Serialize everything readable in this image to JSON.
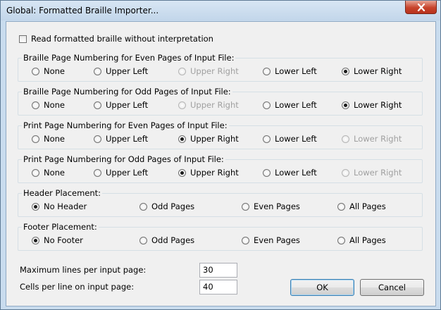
{
  "window": {
    "title": "Global: Formatted Braille Importer..."
  },
  "options": {
    "raw_checkbox_label": "Read formatted braille without interpretation",
    "raw_checked": false
  },
  "groups": [
    {
      "label": "Braille Page Numbering for Even Pages of Input File:",
      "options": [
        "None",
        "Upper Left",
        "Upper Right",
        "Lower Left",
        "Lower Right"
      ],
      "selected": "Lower Right",
      "disabled": [
        "Upper Right"
      ]
    },
    {
      "label": "Braille Page Numbering for Odd Pages of Input File:",
      "options": [
        "None",
        "Upper Left",
        "Upper Right",
        "Lower Left",
        "Lower Right"
      ],
      "selected": "Lower Right",
      "disabled": [
        "Upper Right"
      ]
    },
    {
      "label": "Print Page Numbering for Even Pages of Input File:",
      "options": [
        "None",
        "Upper Left",
        "Upper Right",
        "Lower Left",
        "Lower Right"
      ],
      "selected": "Upper Right",
      "disabled": [
        "Lower Right"
      ]
    },
    {
      "label": "Print Page Numbering for Odd Pages of Input File:",
      "options": [
        "None",
        "Upper Left",
        "Upper Right",
        "Lower Left",
        "Lower Right"
      ],
      "selected": "Upper Right",
      "disabled": [
        "Lower Right"
      ]
    },
    {
      "label": "Header Placement:",
      "options": [
        "No Header",
        "Odd Pages",
        "Even Pages",
        "All Pages"
      ],
      "selected": "No Header",
      "disabled": []
    },
    {
      "label": "Footer Placement:",
      "options": [
        "No Footer",
        "Odd Pages",
        "Even Pages",
        "All Pages"
      ],
      "selected": "No Footer",
      "disabled": []
    }
  ],
  "fields": {
    "max_lines_label": "Maximum lines per input page:",
    "max_lines_value": "30",
    "cells_label": "Cells per line on input page:",
    "cells_value": "40"
  },
  "buttons": {
    "ok": "OK",
    "cancel": "Cancel"
  },
  "icons": {
    "close": "close-icon"
  }
}
